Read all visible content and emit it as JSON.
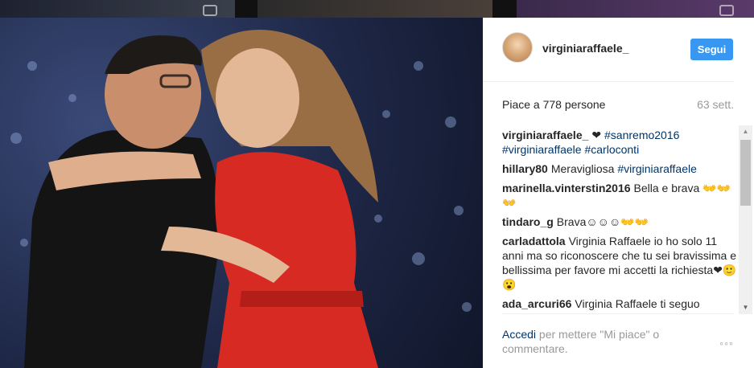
{
  "post": {
    "username": "virginiaraffaele_",
    "follow_label": "Segui",
    "likes_text": "Piace a 778 persone",
    "time_text": "63 sett.",
    "comments": [
      {
        "author": "virginiaraffaele_",
        "text": "❤ ",
        "tags": "#sanremo2016 #virginiaraffaele #carloconti"
      },
      {
        "author": "hillary80",
        "text": "Meravigliosa ",
        "tags": "#virginiaraffaele"
      },
      {
        "author": "marinella.vinterstin2016",
        "text": "Bella e brava 👐👐👐",
        "tags": ""
      },
      {
        "author": "tindaro_g",
        "text": "Brava☺☺☺👐👐",
        "tags": ""
      },
      {
        "author": "carladattola",
        "text": "Virginia Raffaele io ho solo 11 anni ma so riconoscere che tu sei bravissima e bellissima per favore mi accetti la richiesta❤🙂😮",
        "tags": ""
      },
      {
        "author": "ada_arcuri66",
        "text": "Virginia Raffaele ti seguo",
        "tags": ""
      }
    ],
    "login_link": "Accedi",
    "login_rest": " per mettere \"Mi piace\" o commentare.",
    "more_label": "◦◦◦"
  },
  "icons": {
    "scroll_up": "▲",
    "scroll_down": "▼"
  },
  "colors": {
    "follow_button": "#3897f0",
    "hashtag": "#003569",
    "dress": "#d62a22"
  }
}
